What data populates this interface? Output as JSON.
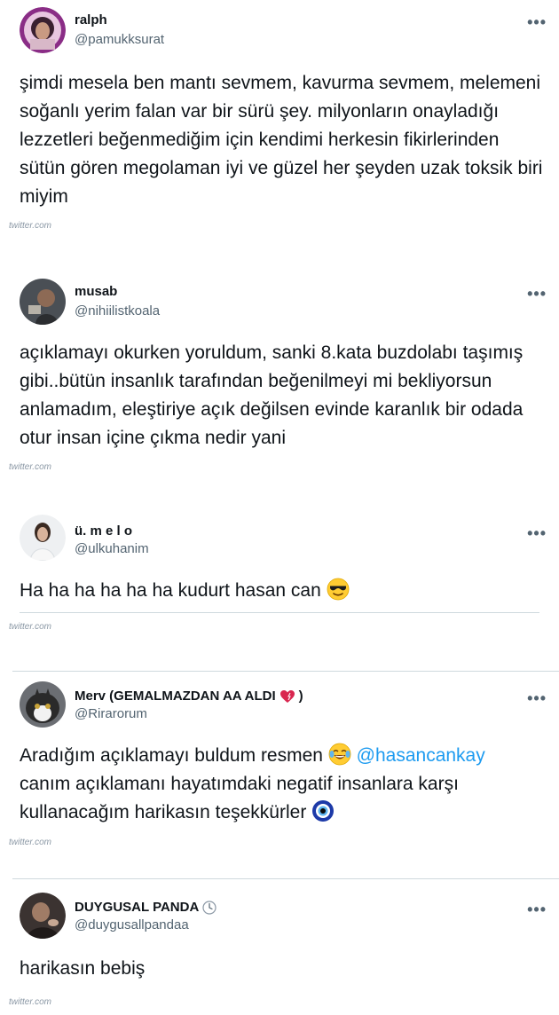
{
  "source_label": "twitter.com",
  "more_label": "•••",
  "tweets": [
    {
      "name": "ralph",
      "handle": "@pamukksurat",
      "text": "şimdi mesela ben mantı sevmem, kavurma sevmem, melemeni soğanlı yerim falan var bir sürü şey. milyonların onayladığı lezzetleri beğenmediğim için kendimi herkesin fikirlerinden sütün gören megolaman iyi ve güzel her şeyden uzak toksik biri miyim"
    },
    {
      "name": "musab",
      "handle": "@nihiilistkoala",
      "text": "açıklamayı okurken yoruldum, sanki 8.kata buzdolabı taşımış gibi..bütün insanlık tarafından beğenilmeyi mi bekliyorsun anlamadım, eleştiriye açık değilsen evinde karanlık bir odada otur insan içine çıkma nedir yani"
    },
    {
      "name": "ü. m e l o",
      "handle": "@ulkuhanim",
      "text": "Ha ha ha ha ha ha kudurt hasan can",
      "emoji": "sunglasses-face"
    },
    {
      "name": "Merv (GEMALMAZDAN AA ALDI",
      "name_suffix": ")",
      "name_icon": "heart-icon",
      "handle": "@Rirarorum",
      "text_before": "Aradığım açıklamayı buldum resmen",
      "mention": "@hasancankay",
      "text_after": "canım açıklamanı hayatımdaki negatif insanlara karşı kullanacağım harikasın teşekkürler",
      "emoji_1": "tears-of-joy-face",
      "emoji_2": "nazar-amulet"
    },
    {
      "name": "DUYGUSAL PANDA",
      "name_icon": "clock-icon",
      "handle": "@duygusallpandaa",
      "text": "harikasın bebiş"
    }
  ],
  "colors": {
    "text": "#0f1419",
    "secondary": "#536471",
    "mention": "#1d9bf0",
    "divider": "#cfd9de"
  }
}
